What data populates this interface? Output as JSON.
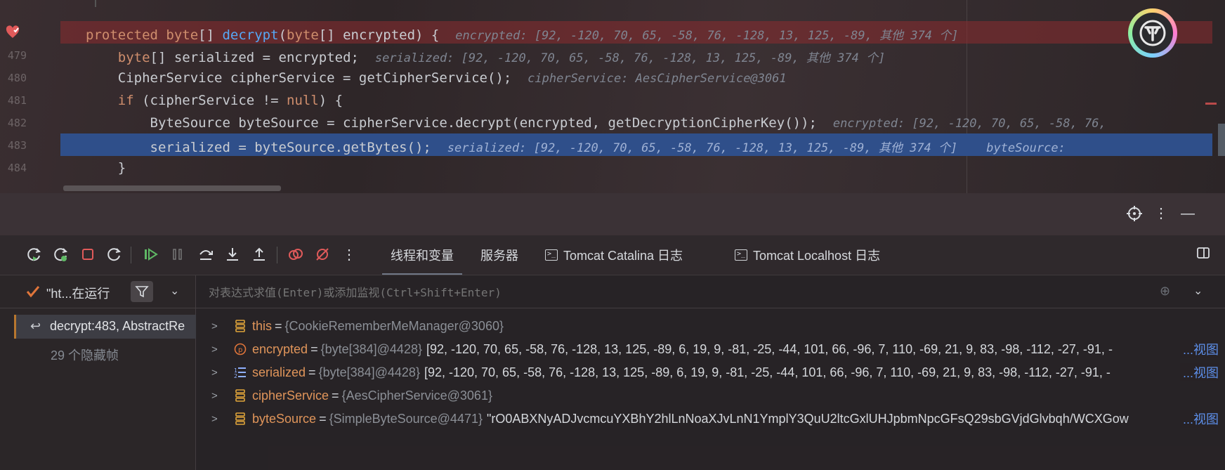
{
  "editor": {
    "lines": [
      {
        "num": "",
        "code_html": "<span class='kw'>protected byte</span>[] <span class='fn'>decrypt</span>(<span class='kw'>byte</span>[] encrypted) {  ",
        "hint": "encrypted: [92, -120, 70, 65, -58, 76, -128, 13, 125, -89, 其他 374 个]"
      },
      {
        "num": "479",
        "code_html": "    <span class='kw'>byte</span>[] serialized = encrypted;  ",
        "hint": "serialized: [92, -120, 70, 65, -58, 76, -128, 13, 125, -89, 其他 374 个]"
      },
      {
        "num": "480",
        "code_html": "    CipherService cipherService = getCipherService();  ",
        "hint": "cipherService: AesCipherService@3061"
      },
      {
        "num": "481",
        "code_html": "    <span class='kw'>if</span> (cipherService != <span class='kw'>null</span>) {",
        "hint": ""
      },
      {
        "num": "482",
        "code_html": "        ByteSource byteSource = cipherService.decrypt(encrypted, getDecryptionCipherKey());  ",
        "hint": "encrypted: [92, -120, 70, 65, -58, 76,"
      },
      {
        "num": "483",
        "code_html": "        serialized = byteSource.getBytes();  ",
        "hint": "serialized: [92, -120, 70, 65, -58, 76, -128, 13, 125, -89, 其他 374 个]    byteSource:"
      },
      {
        "num": "484",
        "code_html": "    }",
        "hint": ""
      }
    ]
  },
  "toolbar": {
    "tabs": [
      "线程和变量",
      "服务器",
      "Tomcat Catalina 日志",
      "Tomcat Localhost 日志"
    ]
  },
  "frames": {
    "thread_label": "\"ht...在运行",
    "current_frame": "decrypt:483, AbstractRe",
    "hidden_frames": "29 个隐藏帧"
  },
  "vars": {
    "eval_placeholder": "对表达式求值(Enter)或添加监视(Ctrl+Shift+Enter)",
    "view_label": "...视图",
    "rows": [
      {
        "name": "this",
        "type": "{CookieRememberMeManager@3060}",
        "value": "",
        "icon": "field-icon"
      },
      {
        "name": "encrypted",
        "type": "{byte[384]@4428}",
        "value": "[92, -120, 70, 65, -58, 76, -128, 13, 125, -89, 6, 19, 9, -81, -25, -44, 101, 66, -96, 7, 110, -69, 21, 9, 83, -98, -112, -27, -91, -",
        "icon": "parameter-icon",
        "has_view": true
      },
      {
        "name": "serialized",
        "type": "{byte[384]@4428}",
        "value": "[92, -120, 70, 65, -58, 76, -128, 13, 125, -89, 6, 19, 9, -81, -25, -44, 101, 66, -96, 7, 110, -69, 21, 9, 83, -98, -112, -27, -91, -",
        "icon": "local-array-icon",
        "has_view": true
      },
      {
        "name": "cipherService",
        "type": "{AesCipherService@3061}",
        "value": "",
        "icon": "field-icon"
      },
      {
        "name": "byteSource",
        "type": "{SimpleByteSource@4471}",
        "value": "\"rO0ABXNyADJvcmcuYXBhY2hlLnNoaXJvLnN1YmplY3QuU2ltcGxlUHJpbmNpcGFsQ29sbGVjdGlvbqh/WCXGow",
        "icon": "field-icon",
        "has_view": true
      }
    ]
  },
  "colors": {
    "accent_link": "#5c8ee8",
    "current_line": "#2f4f8a",
    "breakpoint_line": "#8c2c30"
  }
}
